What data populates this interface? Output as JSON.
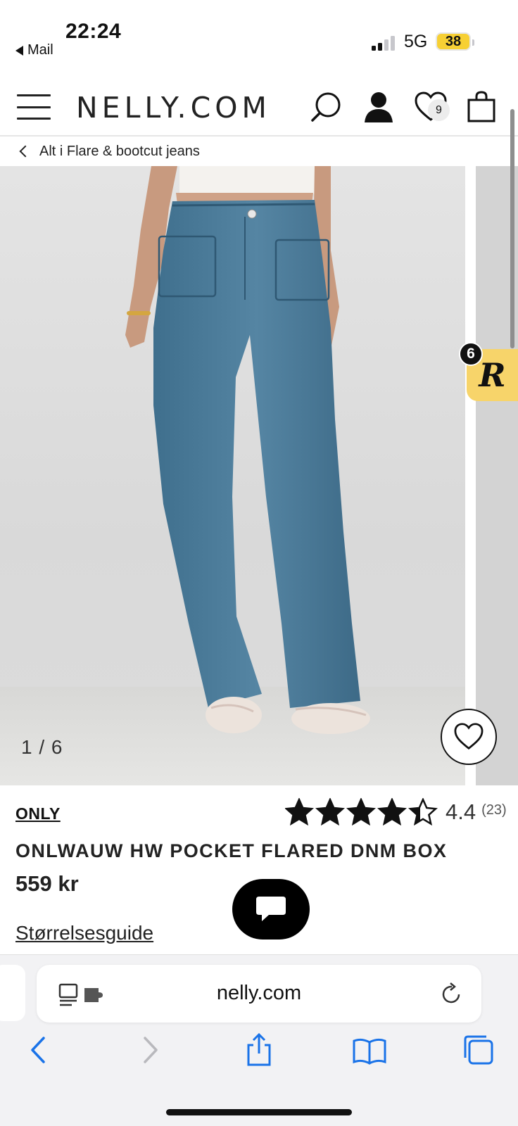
{
  "status_bar": {
    "time": "22:24",
    "back_app": "Mail",
    "network": "5G",
    "battery": "38"
  },
  "header": {
    "logo": "NELLY.COM",
    "wishlist_count": "9"
  },
  "breadcrumb": {
    "label": "Alt i Flare & bootcut jeans"
  },
  "gallery": {
    "counter": "1 / 6",
    "badge_count": "6",
    "badge_letter": "R"
  },
  "product": {
    "brand": "ONLY",
    "rating": "4.4",
    "reviews": "(23)",
    "rating_value": 4.4,
    "rating_max": 5,
    "title": "ONLWAUW HW POCKET FLARED DNM BOX",
    "price": "559 kr",
    "size_guide": "Størrelsesguide"
  },
  "browser": {
    "url": "nelly.com",
    "accent": "#1a73e8"
  },
  "icons": {
    "menu": "hamburger-icon",
    "search": "search-icon",
    "account": "person-icon",
    "wishlist": "heart-icon",
    "bag": "bag-icon",
    "chat": "chat-icon",
    "share": "share-icon",
    "bookmarks": "book-icon",
    "tabs": "tabs-icon"
  }
}
